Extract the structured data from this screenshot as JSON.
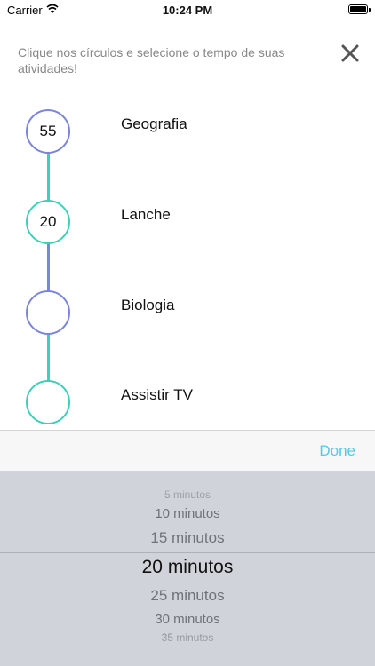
{
  "status_bar": {
    "carrier": "Carrier",
    "time": "10:24 PM"
  },
  "header": {
    "instruction": "Clique nos círculos e selecione o tempo de suas atividades!"
  },
  "colors": {
    "purple": "#7b86d6",
    "teal": "#3fcfb9",
    "done": "#56c8e6"
  },
  "activities": [
    {
      "minutes": "55",
      "label": "Geografia",
      "ring": "purple"
    },
    {
      "minutes": "20",
      "label": "Lanche",
      "ring": "teal"
    },
    {
      "minutes": "",
      "label": "Biologia",
      "ring": "purple"
    },
    {
      "minutes": "",
      "label": "Assistir TV",
      "ring": "teal"
    }
  ],
  "toolbar": {
    "done_label": "Done"
  },
  "picker": {
    "options": [
      "5 minutos",
      "10 minutos",
      "15 minutos",
      "20 minutos",
      "25 minutos",
      "30 minutos",
      "35 minutos"
    ],
    "selected": "20 minutos"
  }
}
